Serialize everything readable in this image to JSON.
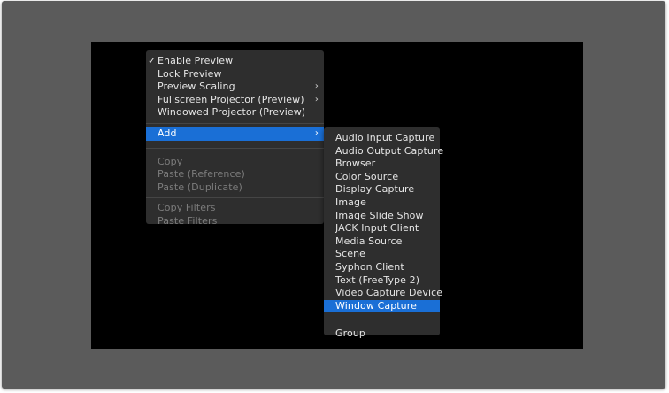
{
  "context_menu": {
    "check_symbol": "✓",
    "items": [
      {
        "label": "Enable Preview",
        "checked": true
      },
      {
        "label": "Lock Preview"
      },
      {
        "label": "Preview Scaling",
        "submenu": true
      },
      {
        "label": "Fullscreen Projector (Preview)",
        "submenu": true
      },
      {
        "label": "Windowed Projector (Preview)"
      },
      {
        "label": "Add",
        "submenu": true,
        "highlighted": true
      },
      {
        "label": "Copy",
        "disabled": true
      },
      {
        "label": "Paste (Reference)",
        "disabled": true
      },
      {
        "label": "Paste (Duplicate)",
        "disabled": true
      },
      {
        "label": "Copy Filters",
        "disabled": true
      },
      {
        "label": "Paste Filters",
        "disabled": true
      }
    ],
    "arrow_symbol": "›"
  },
  "add_submenu": {
    "items": [
      {
        "label": "Audio Input Capture"
      },
      {
        "label": "Audio Output Capture"
      },
      {
        "label": "Browser"
      },
      {
        "label": "Color Source"
      },
      {
        "label": "Display Capture"
      },
      {
        "label": "Image"
      },
      {
        "label": "Image Slide Show"
      },
      {
        "label": "JACK Input Client"
      },
      {
        "label": "Media Source"
      },
      {
        "label": "Scene"
      },
      {
        "label": "Syphon Client"
      },
      {
        "label": "Text (FreeType 2)"
      },
      {
        "label": "Video Capture Device"
      },
      {
        "label": "Window Capture",
        "highlighted": true
      },
      {
        "label": "Group"
      }
    ]
  },
  "colors": {
    "menu_background": "#2e2e2e",
    "highlight": "#1a6fd6",
    "canvas": "#000000",
    "window_background": "#5b5b5b"
  }
}
